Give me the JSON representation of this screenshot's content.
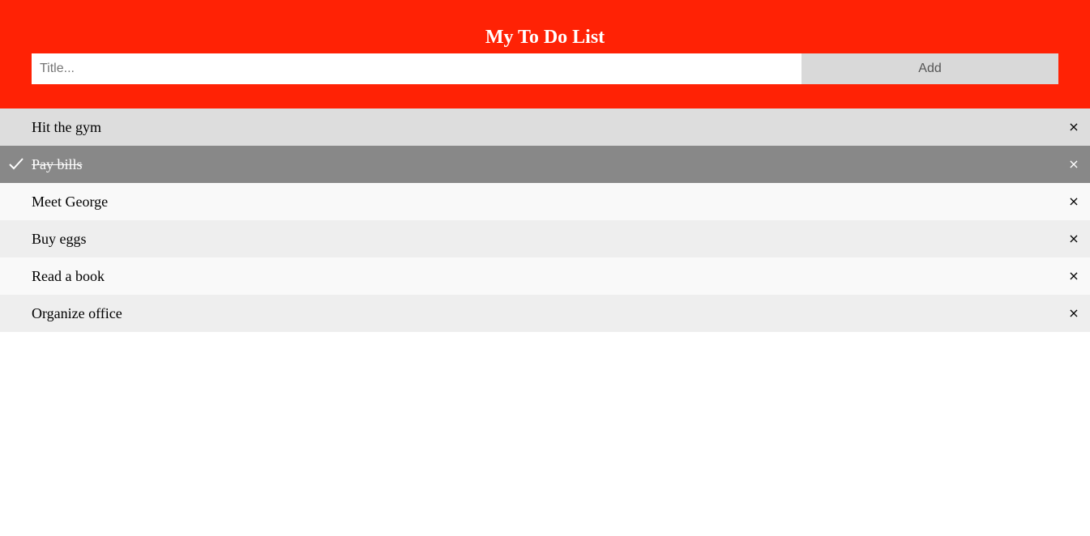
{
  "header": {
    "title": "My To Do List",
    "input_placeholder": "Title...",
    "add_label": "Add"
  },
  "colors": {
    "header_bg": "#ff2205",
    "checked_bg": "#888888",
    "hover_bg": "#dddddd",
    "row_odd_bg": "#f9f9f9",
    "row_even_bg": "#eeeeee"
  },
  "todos": [
    {
      "label": "Hit the gym",
      "checked": false,
      "close_icon": "×"
    },
    {
      "label": "Pay bills",
      "checked": true,
      "close_icon": "×"
    },
    {
      "label": "Meet George",
      "checked": false,
      "close_icon": "×"
    },
    {
      "label": "Buy eggs",
      "checked": false,
      "close_icon": "×"
    },
    {
      "label": "Read a book",
      "checked": false,
      "close_icon": "×"
    },
    {
      "label": "Organize office",
      "checked": false,
      "close_icon": "×"
    }
  ]
}
